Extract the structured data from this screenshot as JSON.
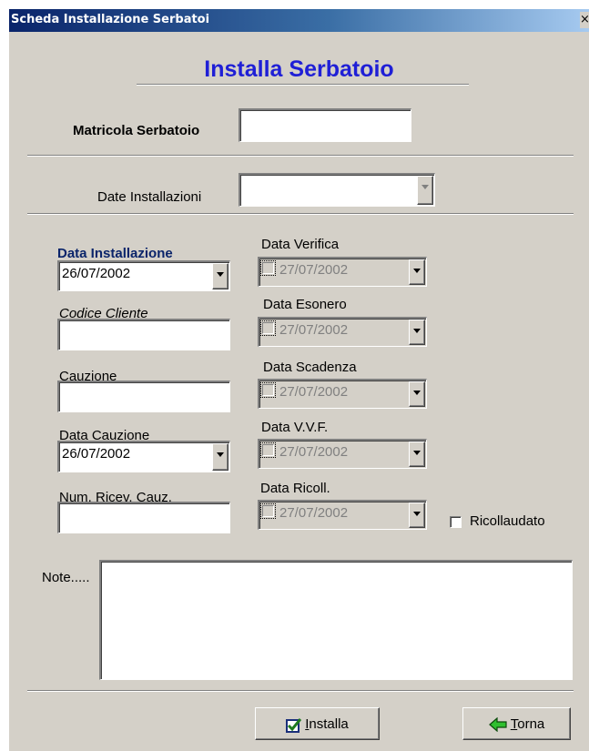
{
  "window": {
    "title": "Scheda Installazione Serbatoi",
    "close_glyph": "×"
  },
  "heading": "Installa Serbatoio",
  "matricola": {
    "label": "Matricola Serbatoio",
    "value": ""
  },
  "date_installazioni": {
    "label": "Date Installazioni",
    "value": ""
  },
  "left_fields": {
    "data_installazione": {
      "label": "Data Installazione",
      "value": "26/07/2002"
    },
    "codice_cliente": {
      "label": "Codice Cliente",
      "value": ""
    },
    "cauzione": {
      "label": "Cauzione",
      "value": ""
    },
    "data_cauzione": {
      "label": "Data Cauzione",
      "value": "26/07/2002"
    },
    "num_ricev_cauz": {
      "label": "Num. Ricev. Cauz.",
      "value": ""
    }
  },
  "right_fields": {
    "data_verifica": {
      "label": "Data Verifica",
      "value": "27/07/2002",
      "checked": false
    },
    "data_esonero": {
      "label": "Data Esonero",
      "value": "27/07/2002",
      "checked": false
    },
    "data_scadenza": {
      "label": "Data Scadenza",
      "value": "27/07/2002",
      "checked": false
    },
    "data_vvf": {
      "label": "Data V.V.F.",
      "value": "27/07/2002",
      "checked": false
    },
    "data_ricoll": {
      "label": "Data Ricoll.",
      "value": "27/07/2002",
      "checked": false
    }
  },
  "ricollaudato": {
    "label": "Ricollaudato",
    "checked": false
  },
  "note": {
    "label": "Note.....",
    "value": ""
  },
  "buttons": {
    "installa": {
      "underline": "I",
      "rest": "nstalla",
      "icon": "checkbox-check-icon"
    },
    "torna": {
      "underline": "T",
      "rest": "orna",
      "icon": "green-arrow-left-icon"
    }
  },
  "colors": {
    "heading": "#1f1fd6",
    "blue_label": "#0a246a",
    "face": "#d4d0c8",
    "arrow_green": "#2fbf2f"
  }
}
